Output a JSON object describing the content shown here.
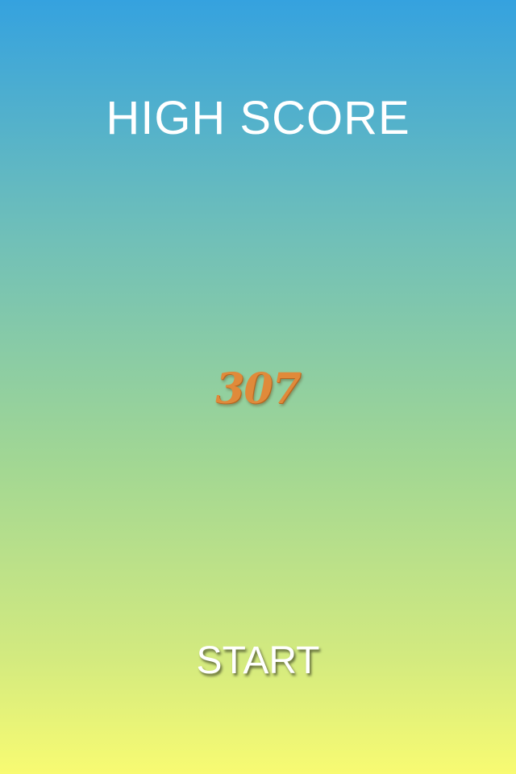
{
  "title": "HIGH SCORE",
  "score": "307",
  "start_label": "START",
  "colors": {
    "gradient_top": "#35a2df",
    "gradient_bottom": "#f8fb72",
    "score_color": "#e08a3a",
    "text_color": "#ffffff"
  }
}
